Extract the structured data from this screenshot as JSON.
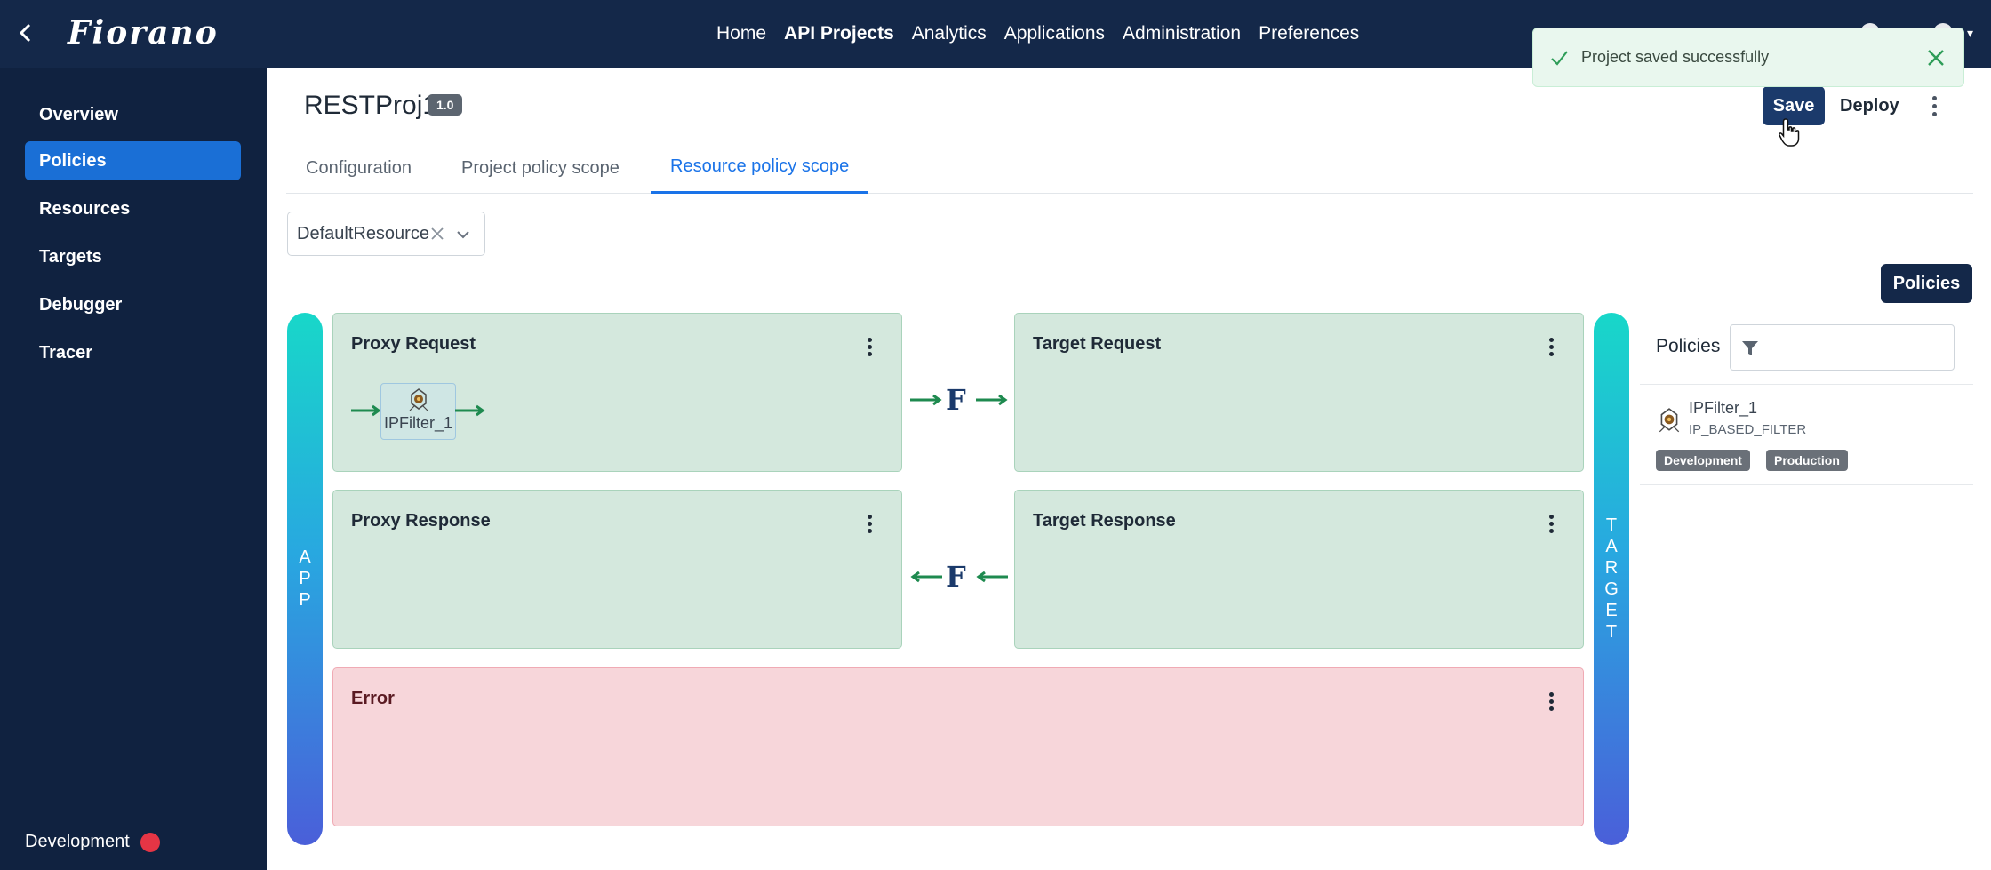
{
  "topbar": {
    "logo": "Fiorano",
    "nav": [
      "Home",
      "API Projects",
      "Analytics",
      "Applications",
      "Administration",
      "Preferences"
    ],
    "active_nav": "API Projects"
  },
  "sidebar": {
    "items": [
      {
        "label": "Overview"
      },
      {
        "label": "Policies"
      },
      {
        "label": "Resources"
      },
      {
        "label": "Targets"
      },
      {
        "label": "Debugger"
      },
      {
        "label": "Tracer"
      }
    ],
    "active": "Policies",
    "environment": "Development"
  },
  "project": {
    "title": "RESTProj1",
    "version": "1.0"
  },
  "actions": {
    "save": "Save",
    "deploy": "Deploy"
  },
  "toast": {
    "message": "Project saved successfully"
  },
  "tabs": [
    {
      "label": "Configuration"
    },
    {
      "label": "Project policy scope"
    },
    {
      "label": "Resource policy scope"
    }
  ],
  "active_tab": "Resource policy scope",
  "resource_select": {
    "value": "DefaultResource"
  },
  "flow": {
    "app_label": "APP",
    "target_label": "TARGET",
    "proxy_request": {
      "title": "Proxy Request",
      "policy": "IPFilter_1"
    },
    "target_request": {
      "title": "Target Request"
    },
    "proxy_response": {
      "title": "Proxy Response"
    },
    "target_response": {
      "title": "Target Response"
    },
    "error": {
      "title": "Error"
    },
    "connector_glyph": "F"
  },
  "policies_panel": {
    "button": "Policies",
    "title": "Policies",
    "items": [
      {
        "name": "IPFilter_1",
        "type": "IP_BASED_FILTER",
        "tags": [
          "Development",
          "Production"
        ]
      }
    ]
  },
  "colors": {
    "topbar": "#142849",
    "sidebar": "#102240",
    "active_sidebar": "#1a6fd6",
    "flow_box": "#d4e8dd",
    "error_box": "#f7d6da",
    "arrow": "#1e8a4f",
    "accent": "#1a73e8",
    "env_status": "#e53545"
  }
}
